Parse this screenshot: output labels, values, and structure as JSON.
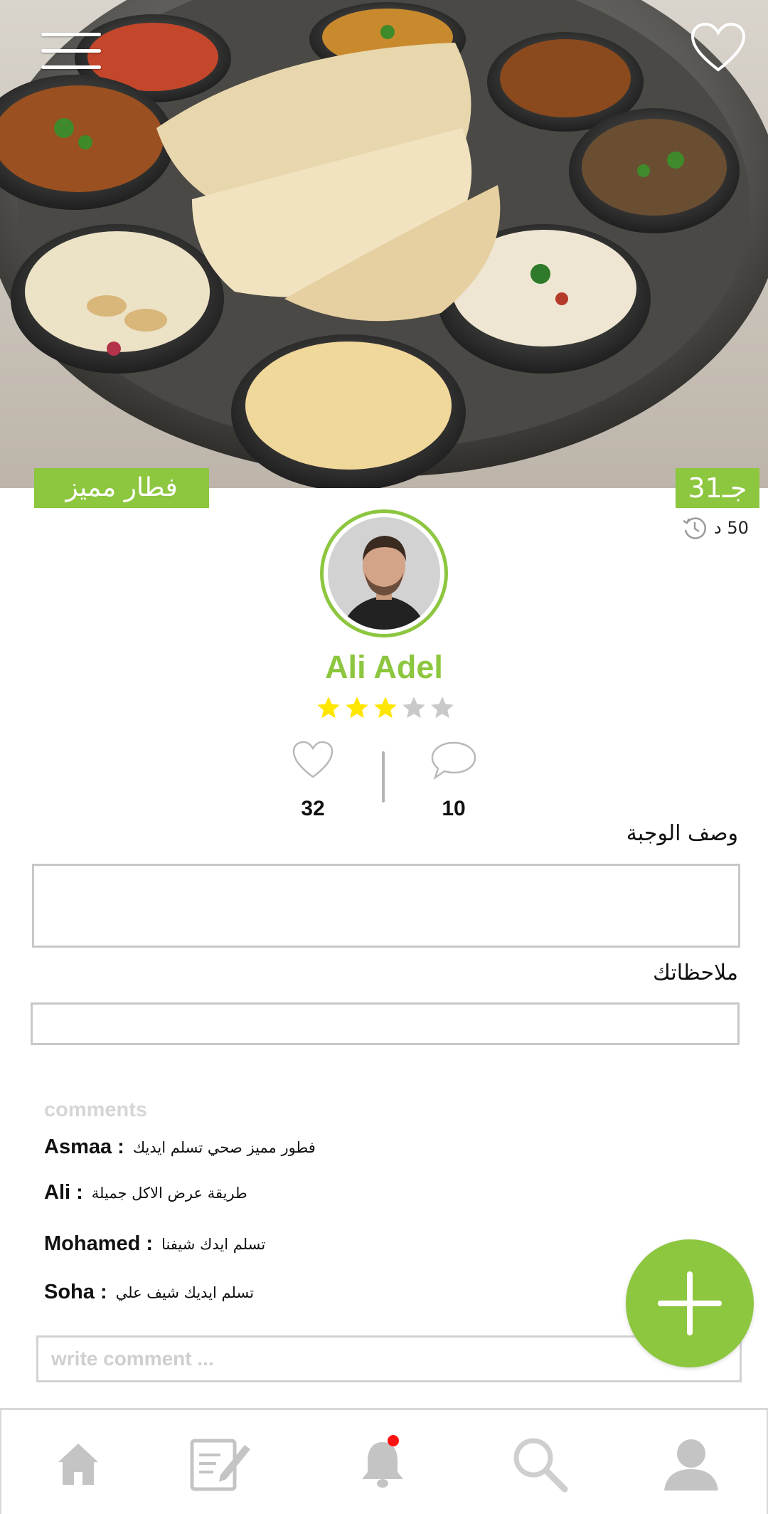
{
  "header": {
    "menu_icon": "hamburger-menu-icon",
    "favorite_icon": "heart-outline-icon"
  },
  "meal": {
    "title": "فطار مميز",
    "price": "31جـ",
    "time": "50 د",
    "time_icon": "history-clock-icon"
  },
  "chef": {
    "name": "Ali Adel",
    "rating": 3,
    "rating_max": 5,
    "likes": "32",
    "comments": "10",
    "likes_icon": "heart-outline-icon",
    "comments_icon": "speech-bubble-icon"
  },
  "form": {
    "description_label": "وصف الوجبة",
    "description_value": "",
    "notes_label": "ملاحظاتك",
    "notes_value": ""
  },
  "comments": {
    "title": "comments",
    "items": [
      {
        "author": "Asmaa :",
        "text": "فطور مميز صحي تسلم ايديك"
      },
      {
        "author": "Ali :",
        "text": "طريقة عرض الاكل جميلة"
      },
      {
        "author": "Mohamed :",
        "text": "تسلم ايدك شيفنا"
      },
      {
        "author": "Soha :",
        "text": "تسلم ايديك شيف علي"
      }
    ],
    "input_placeholder": "write comment ..."
  },
  "fab": {
    "icon": "plus-icon"
  },
  "nav": {
    "items": [
      {
        "icon": "home-icon"
      },
      {
        "icon": "edit-note-icon"
      },
      {
        "icon": "bell-icon",
        "badge": true
      },
      {
        "icon": "search-icon"
      },
      {
        "icon": "user-icon"
      }
    ]
  },
  "colors": {
    "accent": "#8dc63f",
    "star_active": "#ffe600",
    "star_inactive": "#c9c9c9",
    "nav_icon": "#c4c4c4",
    "badge": "#ff1010"
  }
}
